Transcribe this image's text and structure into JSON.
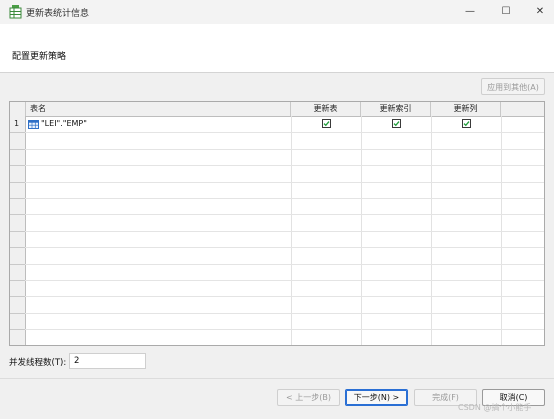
{
  "window": {
    "title": "更新表统计信息",
    "minimize_glyph": "—",
    "maximize_glyph": "☐",
    "close_glyph": "✕"
  },
  "header": {
    "title": "配置更新策略"
  },
  "toolbar": {
    "apply_label": "应用到其他(A)"
  },
  "grid": {
    "columns": [
      "表名",
      "更新表",
      "更新索引",
      "更新列"
    ],
    "rows": [
      {
        "num": "1",
        "table": "\"LEI\".\"EMP\"",
        "update_table": true,
        "update_index": true,
        "update_column": true
      }
    ]
  },
  "settings": {
    "threads_label": "并发线程数(T):",
    "threads_value": "2"
  },
  "footer": {
    "prev_label": "< 上一步(B)",
    "next_label": "下一步(N) >",
    "finish_label": "完成(F)",
    "cancel_label": "取消(C)"
  },
  "watermark": "CSDN @搞个小能手",
  "colors": {
    "accent": "#2a6fd4",
    "checkbox_check": "#1f9d3a"
  },
  "icons": {
    "app": "table-app-icon",
    "table": "table-grid-icon"
  }
}
